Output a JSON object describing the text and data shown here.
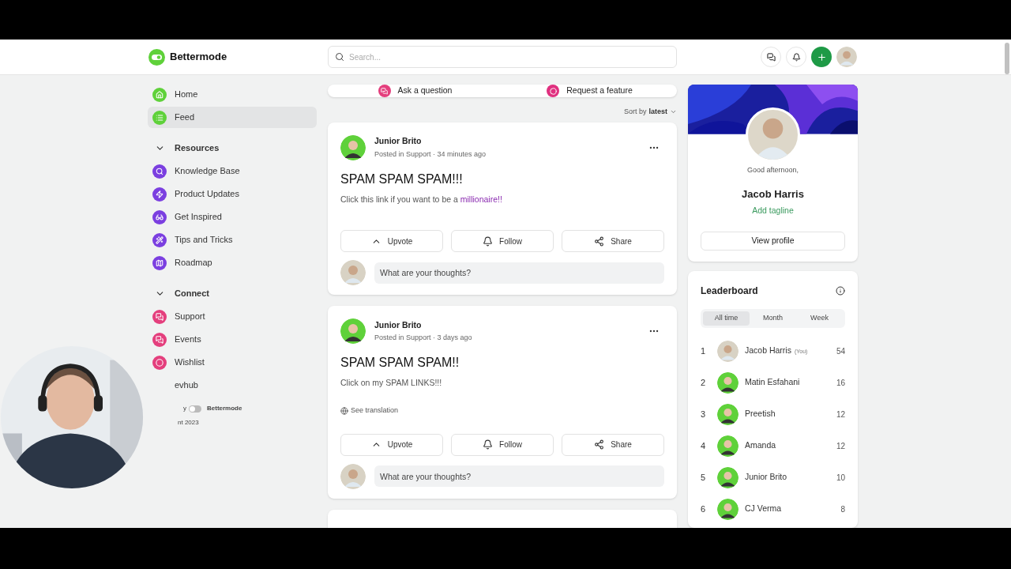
{
  "header": {
    "logo": "Bettermode",
    "search": {
      "placeholder": "Search..."
    }
  },
  "sidebar": {
    "items": [
      {
        "label": "Home",
        "color": "#5fd13a",
        "selected": false
      },
      {
        "label": "Feed",
        "color": "#5fd13a",
        "selected": true
      }
    ],
    "groups": [
      {
        "title": "Resources",
        "expanded": true,
        "items": [
          {
            "label": "Knowledge Base",
            "color": "#7b3fe0",
            "selected": false
          },
          {
            "label": "Product Updates",
            "color": "#7b3fe0",
            "selected": false
          },
          {
            "label": "Get Inspired",
            "color": "#7b3fe0",
            "selected": false
          },
          {
            "label": "Tips and Tricks",
            "color": "#7b3fe0",
            "selected": false
          },
          {
            "label": "Roadmap",
            "color": "#7b3fe0",
            "selected": false
          }
        ]
      },
      {
        "title": "Connect",
        "expanded": true,
        "items": [
          {
            "label": "Support",
            "color": "#e43f7d",
            "selected": false
          },
          {
            "label": "Events",
            "color": "#e43f7d",
            "selected": false
          },
          {
            "label": "Wishlist",
            "color": "#e43f7d",
            "selected": false
          },
          {
            "label": "evhub",
            "selected": false
          }
        ]
      }
    ],
    "footer": {
      "prefix": "y",
      "toggle": {
        "on": false
      },
      "brand": "Bettermode",
      "copyright": "nt 2023"
    }
  },
  "feed": {
    "actions": [
      {
        "label": "Ask a question",
        "color": "#e43f7d"
      },
      {
        "label": "Request a feature",
        "color": "#e0307f"
      }
    ],
    "sort": {
      "label": "Sort by",
      "value": "latest"
    },
    "posts": [
      {
        "author": "Junior Brito",
        "meta": "Posted in Support · 34 minutes ago",
        "title": "SPAM SPAM SPAM!!!",
        "body": "Click this link if you want to be a ",
        "link": "millionaire!!",
        "buttons": [
          "Upvote",
          "Follow",
          "Share"
        ],
        "comment_placeholder": "What are your thoughts?"
      },
      {
        "author": "Junior Brito",
        "meta": "Posted in Support · 3 days ago",
        "title": "SPAM SPAM SPAM!!",
        "body": "Click on my SPAM LINKS!!!",
        "translation": "See translation",
        "buttons": [
          "Upvote",
          "Follow",
          "Share"
        ],
        "comment_placeholder": "What are your thoughts?"
      }
    ]
  },
  "profile": {
    "greeting": "Good afternoon,",
    "name": "Jacob Harris",
    "tagline": "Add tagline",
    "button": "View profile"
  },
  "leaderboard": {
    "title": "Leaderboard",
    "tabs": [
      {
        "label": "All time",
        "selected": true
      },
      {
        "label": "Month",
        "selected": false
      },
      {
        "label": "Week",
        "selected": false
      }
    ],
    "rows": [
      {
        "rank": "1",
        "name": "Jacob Harris",
        "suffix": "(You)",
        "score": "54"
      },
      {
        "rank": "2",
        "name": "Matin Esfahani",
        "score": "16"
      },
      {
        "rank": "3",
        "name": "Preetish",
        "score": "12"
      },
      {
        "rank": "4",
        "name": "Amanda",
        "score": "12"
      },
      {
        "rank": "5",
        "name": "Junior Brito",
        "score": "10"
      },
      {
        "rank": "6",
        "name": "CJ Verma",
        "score": "8"
      }
    ]
  }
}
